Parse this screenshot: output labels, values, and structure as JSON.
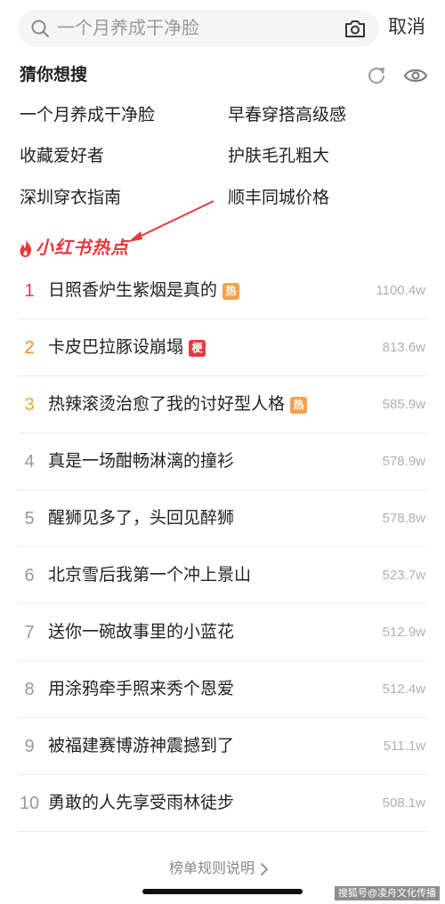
{
  "search": {
    "query": "一个月养成干净脸",
    "cancel_label": "取消"
  },
  "suggestions": {
    "title": "猜你想搜",
    "items": [
      "一个月养成干净脸",
      "早春穿搭高级感",
      "收藏爱好者",
      "护肤毛孔粗大",
      "深圳穿衣指南",
      "顺丰同城价格"
    ]
  },
  "hot": {
    "title": "小红书热点",
    "items": [
      {
        "rank": "1",
        "name": "日照香炉生紫烟是真的",
        "tag": "热",
        "count": "1100.4w"
      },
      {
        "rank": "2",
        "name": "卡皮巴拉豚设崩塌",
        "tag": "梗",
        "count": "813.6w"
      },
      {
        "rank": "3",
        "name": "热辣滚烫治愈了我的讨好型人格",
        "tag": "热",
        "count": "585.9w"
      },
      {
        "rank": "4",
        "name": "真是一场酣畅淋漓的撞衫",
        "tag": "",
        "count": "578.9w"
      },
      {
        "rank": "5",
        "name": "醒狮见多了，头回见醉狮",
        "tag": "",
        "count": "578.8w"
      },
      {
        "rank": "6",
        "name": "北京雪后我第一个冲上景山",
        "tag": "",
        "count": "523.7w"
      },
      {
        "rank": "7",
        "name": "送你一碗故事里的小蓝花",
        "tag": "",
        "count": "512.9w"
      },
      {
        "rank": "8",
        "name": "用涂鸦牵手照来秀个恩爱",
        "tag": "",
        "count": "512.4w"
      },
      {
        "rank": "9",
        "name": "被福建赛博游神震撼到了",
        "tag": "",
        "count": "511.1w"
      },
      {
        "rank": "10",
        "name": "勇敢的人先享受雨林徒步",
        "tag": "",
        "count": "508.1w"
      }
    ]
  },
  "footer": {
    "rules_label": "榜单规则说明",
    "watermark": "搜狐号@凌舟文化传播"
  },
  "colors": {
    "accent_red": "#e8383f",
    "rank2": "#f08a24",
    "rank3": "#e9a53a",
    "tag_hot": "#f5a14a"
  }
}
